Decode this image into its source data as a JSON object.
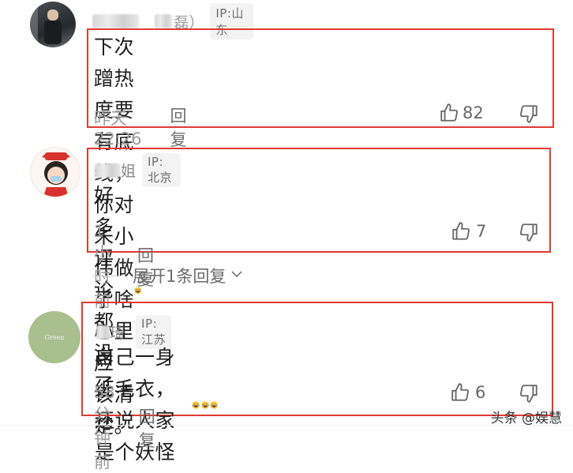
{
  "comments": [
    {
      "name_visible": "磊）",
      "ip": "IP:山东",
      "text_line1": "下次蹭热度要有底线，你对朱小伟做了啥心里应",
      "text_line2": "该清楚。",
      "time": "昨天22:26",
      "reply": "回复",
      "likes": "82"
    },
    {
      "name_visible": "姐",
      "ip": "IP:北京",
      "text": "好多评论都没了",
      "time": "1小时前",
      "reply": "回复",
      "likes": "7"
    },
    {
      "name_visible": "琦",
      "ip": "IP:江苏",
      "avatar_text": "Green",
      "text": "自己一身红毛衣，还说人家是个妖怪",
      "time": "58分钟前",
      "reply": "回复",
      "likes": "6"
    }
  ],
  "expand_replies": "展开1条回复",
  "watermark": "头条 @娱慧",
  "colors": {
    "highlight_box": "#e23a30",
    "ip_badge_bg": "#f3f3f3",
    "avatar3_bg": "#a8bf8e"
  },
  "icons": [
    "thumbs-up-icon",
    "thumbs-down-icon",
    "laughing-crying-emoji-icon",
    "chevron-down-icon"
  ]
}
